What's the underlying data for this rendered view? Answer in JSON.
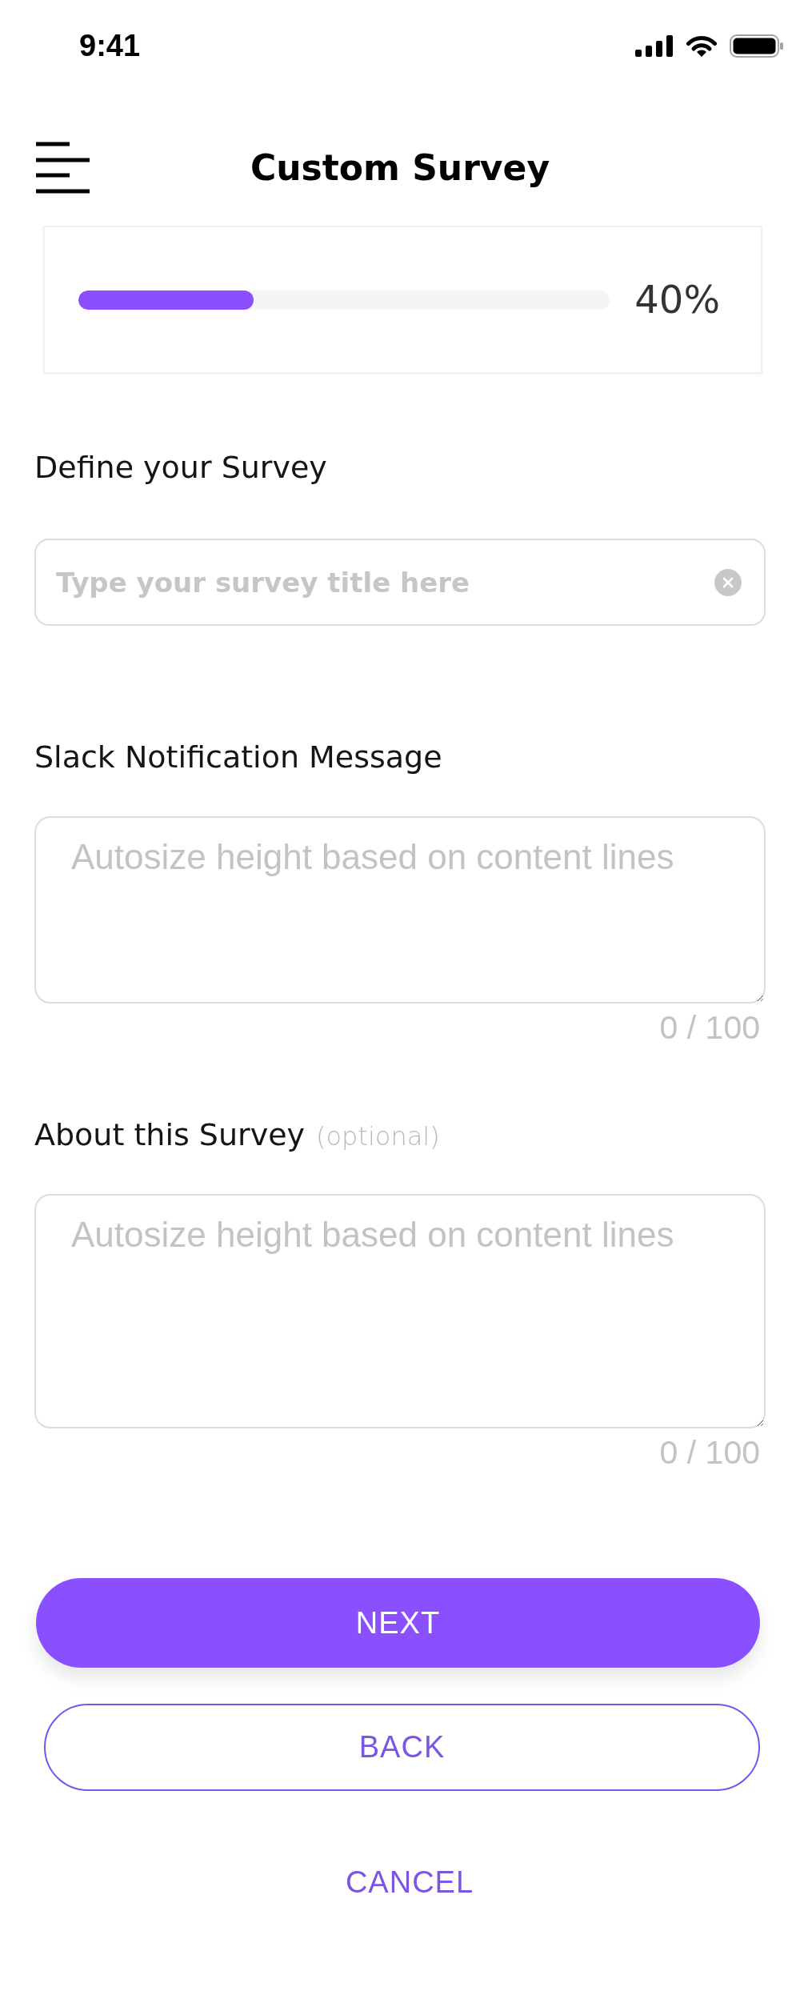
{
  "status_bar": {
    "time": "9:41"
  },
  "header": {
    "title": "Custom Survey"
  },
  "progress": {
    "level": 0.33,
    "reading": "40%"
  },
  "fields": [
    {
      "kind": "input",
      "label": "Define your Survey",
      "placeholder": "Type your survey title here"
    },
    {
      "kind": "textarea",
      "label": "Slack Notification Message",
      "placeholder": "Autosize height based on content lines",
      "counter": "0 / 100"
    },
    {
      "kind": "textarea",
      "label": "About this Survey",
      "hint": "(optional)",
      "placeholder": "Autosize height based on content lines",
      "counter": "0 / 100"
    }
  ],
  "buttons": [
    {
      "kind": "primary",
      "label": "NEXT"
    },
    {
      "kind": "outline",
      "label": "BACK"
    },
    {
      "kind": "text",
      "label": "CANCEL"
    }
  ]
}
